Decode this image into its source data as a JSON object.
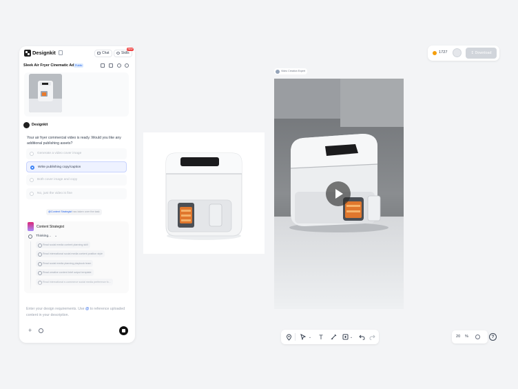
{
  "app": {
    "brand": "Designkit"
  },
  "header": {
    "chat_label": "Chat",
    "skills_label": "Skills",
    "skills_badge": "New"
  },
  "project": {
    "title": "Sleek Air Fryer Cinematic Ad",
    "badge": "Public"
  },
  "conversation": {
    "ai_name": "Designkit",
    "ai_message": "Your air fryer commercial video is ready. Would you like any additional publishing assets?",
    "options": [
      {
        "label": "Generate a video cover image",
        "selected": false
      },
      {
        "label": "Write publishing copy/caption",
        "selected": true
      },
      {
        "label": "Both cover image and copy",
        "selected": false
      },
      {
        "label": "No, just the video is fine",
        "selected": false
      }
    ],
    "mention": {
      "tag": "@Content Strategist",
      "rest": "has taken over the task"
    }
  },
  "agent": {
    "name": "Content Strategist",
    "status": "Thinking...",
    "tools": [
      "Read social media content planning skill",
      "Read international social media content position style",
      "Read social media planning playbook team",
      "Read creative content brief output template",
      "Read international e-commerce social media preference fo..."
    ]
  },
  "input": {
    "text_before": "Enter your design requirements. Use ",
    "at": "@",
    "text_after": " to reference uploaded content in your description."
  },
  "canvas": {
    "video_tag": "Video Creation Expert"
  },
  "topbar": {
    "credits": "1727",
    "download_label": "Download"
  },
  "zoom": {
    "value": "20",
    "unit": "%"
  },
  "colors": {
    "accent": "#3b82f6",
    "play_overlay": "#282828",
    "brand_dark": "#1f1f1f",
    "credit": "#f59e0b"
  }
}
